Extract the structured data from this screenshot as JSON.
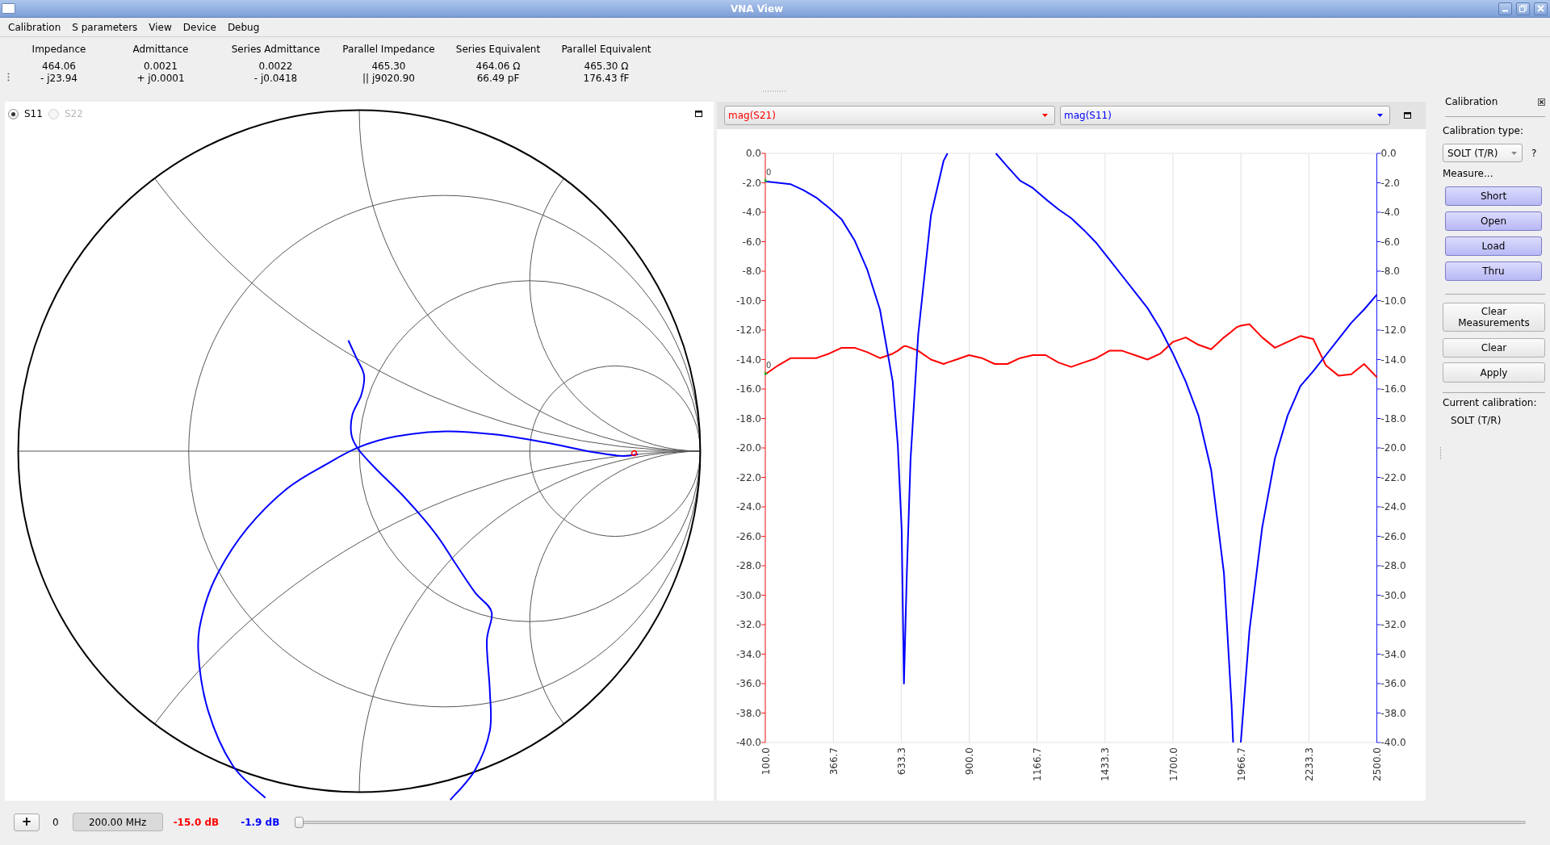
{
  "window": {
    "title": "VNA View"
  },
  "menu": [
    "Calibration",
    "S parameters",
    "View",
    "Device",
    "Debug"
  ],
  "readouts": [
    {
      "heading": "Impedance",
      "lines": [
        "464.06",
        "- j23.94"
      ]
    },
    {
      "heading": "Admittance",
      "lines": [
        "0.0021",
        "+ j0.0001"
      ]
    },
    {
      "heading": "Series Admittance",
      "lines": [
        "0.0022",
        "- j0.0418"
      ]
    },
    {
      "heading": "Parallel Impedance",
      "lines": [
        "465.30",
        "|| j9020.90"
      ]
    },
    {
      "heading": "Series Equivalent",
      "lines": [
        "464.06 Ω",
        "66.49 pF"
      ]
    },
    {
      "heading": "Parallel Equivalent",
      "lines": [
        "465.30 Ω",
        "176.43 fF"
      ]
    }
  ],
  "smith_chart": {
    "ports": [
      {
        "label": "S11",
        "selected": true,
        "disabled": false
      },
      {
        "label": "S22",
        "selected": false,
        "disabled": true
      }
    ]
  },
  "plot": {
    "chart_data": {
      "type": "line",
      "grid": true,
      "x": [
        100,
        150,
        200,
        250,
        300,
        350,
        400,
        450,
        500,
        550,
        600,
        620,
        635,
        644,
        655,
        670,
        700,
        750,
        800,
        815,
        850,
        900,
        950,
        1000,
        1005,
        1050,
        1100,
        1150,
        1200,
        1250,
        1300,
        1350,
        1400,
        1450,
        1500,
        1550,
        1600,
        1650,
        1700,
        1750,
        1800,
        1850,
        1900,
        1930,
        1936,
        1950,
        1966,
        2000,
        2050,
        2100,
        2150,
        2200,
        2250,
        2300,
        2350,
        2400,
        2450,
        2500
      ],
      "series": [
        {
          "name": "mag(S21)",
          "color": "#ff0000",
          "values": [
            -15.0,
            -14.4,
            -13.9,
            -13.9,
            -13.9,
            -13.6,
            -13.2,
            -13.2,
            -13.5,
            -13.9,
            -13.6,
            -13.4,
            -13.2,
            -13.1,
            -13.1,
            -13.2,
            -13.4,
            -14.0,
            -14.3,
            -14.2,
            -14.0,
            -13.7,
            -13.9,
            -14.3,
            -14.3,
            -14.3,
            -13.9,
            -13.7,
            -13.7,
            -14.2,
            -14.5,
            -14.2,
            -13.9,
            -13.4,
            -13.4,
            -13.7,
            -14.0,
            -13.6,
            -12.8,
            -12.5,
            -13.0,
            -13.3,
            -12.5,
            -12.1,
            -12.0,
            -11.8,
            -11.7,
            -11.6,
            -12.5,
            -13.2,
            -12.8,
            -12.4,
            -12.6,
            -14.4,
            -15.1,
            -15.0,
            -14.3,
            -15.2
          ]
        },
        {
          "name": "mag(S11)",
          "color": "#0000ff",
          "values": [
            -1.9,
            -2.0,
            -2.1,
            -2.5,
            -3.0,
            -3.7,
            -4.5,
            -5.9,
            -7.9,
            -10.6,
            -15.5,
            -19.8,
            -25.5,
            -36.0,
            -28.7,
            -20.8,
            -12.3,
            -4.2,
            -0.5,
            0.0,
            null,
            null,
            null,
            null,
            0.0,
            -0.9,
            -1.85,
            -2.35,
            -3.1,
            -3.8,
            -4.4,
            -5.2,
            -6.1,
            -7.2,
            -8.3,
            -9.4,
            -10.5,
            -11.9,
            -13.6,
            -15.5,
            -17.8,
            -21.5,
            -28.5,
            -37.5,
            -40.0,
            null,
            -40.0,
            -32.4,
            -25.4,
            -20.7,
            -17.8,
            -15.8,
            -14.8,
            -13.7,
            -12.6,
            -11.5,
            -10.6,
            -9.6
          ]
        }
      ],
      "xlim": [
        100,
        2500
      ],
      "ylim": [
        -40,
        0
      ],
      "y2lim": [
        -40,
        0
      ],
      "xticks": [
        {
          "value": 100,
          "label": "100.0"
        },
        {
          "value": 366.7,
          "label": "366.7"
        },
        {
          "value": 633.3,
          "label": "633.3"
        },
        {
          "value": 900,
          "label": "900.0"
        },
        {
          "value": 1166.7,
          "label": "1166.7"
        },
        {
          "value": 1433.3,
          "label": "1433.3"
        },
        {
          "value": 1700,
          "label": "1700.0"
        },
        {
          "value": 1966.7,
          "label": "1966.7"
        },
        {
          "value": 2233.3,
          "label": "2233.3"
        },
        {
          "value": 2500,
          "label": "2500.0"
        }
      ],
      "yticks": [
        {
          "value": 0,
          "label": "0.0"
        },
        {
          "value": -2,
          "label": "-2.0"
        },
        {
          "value": -4,
          "label": "-4.0"
        },
        {
          "value": -6,
          "label": "-6.0"
        },
        {
          "value": -8,
          "label": "-8.0"
        },
        {
          "value": -10,
          "label": "-10.0"
        },
        {
          "value": -12,
          "label": "-12.0"
        },
        {
          "value": -14,
          "label": "-14.0"
        },
        {
          "value": -16,
          "label": "-16.0"
        },
        {
          "value": -18,
          "label": "-18.0"
        },
        {
          "value": -20,
          "label": "-20.0"
        },
        {
          "value": -22,
          "label": "-22.0"
        },
        {
          "value": -24,
          "label": "-24.0"
        },
        {
          "value": -26,
          "label": "-26.0"
        },
        {
          "value": -28,
          "label": "-28.0"
        },
        {
          "value": -30,
          "label": "-30.0"
        },
        {
          "value": -32,
          "label": "-32.0"
        },
        {
          "value": -34,
          "label": "-34.0"
        },
        {
          "value": -36,
          "label": "-36.0"
        },
        {
          "value": -38,
          "label": "-38.0"
        },
        {
          "value": -40,
          "label": "-40.0"
        }
      ],
      "y2ticks": [
        {
          "value": 0,
          "label": "0.0"
        },
        {
          "value": -2,
          "label": "-2.0"
        },
        {
          "value": -4,
          "label": "-4.0"
        },
        {
          "value": -6,
          "label": "-6.0"
        },
        {
          "value": -8,
          "label": "-8.0"
        },
        {
          "value": -10,
          "label": "-10.0"
        },
        {
          "value": -12,
          "label": "-12.0"
        },
        {
          "value": -14,
          "label": "-14.0"
        },
        {
          "value": -16,
          "label": "-16.0"
        },
        {
          "value": -18,
          "label": "-18.0"
        },
        {
          "value": -20,
          "label": "-20.0"
        },
        {
          "value": -22,
          "label": "-22.0"
        },
        {
          "value": -24,
          "label": "-24.0"
        },
        {
          "value": -26,
          "label": "-26.0"
        },
        {
          "value": -28,
          "label": "-28.0"
        },
        {
          "value": -30,
          "label": "-30.0"
        },
        {
          "value": -32,
          "label": "-32.0"
        },
        {
          "value": -34,
          "label": "-34.0"
        },
        {
          "value": -36,
          "label": "-36.0"
        },
        {
          "value": -38,
          "label": "-38.0"
        },
        {
          "value": -40,
          "label": "-40.0"
        }
      ],
      "annotations": [
        {
          "x": 100,
          "y": -1.9,
          "text": "0"
        },
        {
          "x": 100,
          "y": -15.0,
          "text": "0"
        }
      ]
    }
  },
  "calibration_panel": {
    "title": "Calibration",
    "type_label": "Calibration type:",
    "type_value": "SOLT (T/R)",
    "help": "?",
    "measure_label": "Measure...",
    "measure_buttons": [
      "Short",
      "Open",
      "Load",
      "Thru"
    ],
    "action_buttons": [
      "Clear Measurements",
      "Clear",
      "Apply"
    ],
    "current_label": "Current calibration:",
    "current_value": "SOLT (T/R)"
  },
  "marker_bar": {
    "add_button": "+",
    "marker_index": "0",
    "frequency": "200.00 MHz",
    "readings": [
      {
        "value": "-15.0 dB",
        "color": "#ff0000"
      },
      {
        "value": "-1.9 dB",
        "color": "#0000ff"
      }
    ],
    "slider": {
      "level": 0
    }
  }
}
